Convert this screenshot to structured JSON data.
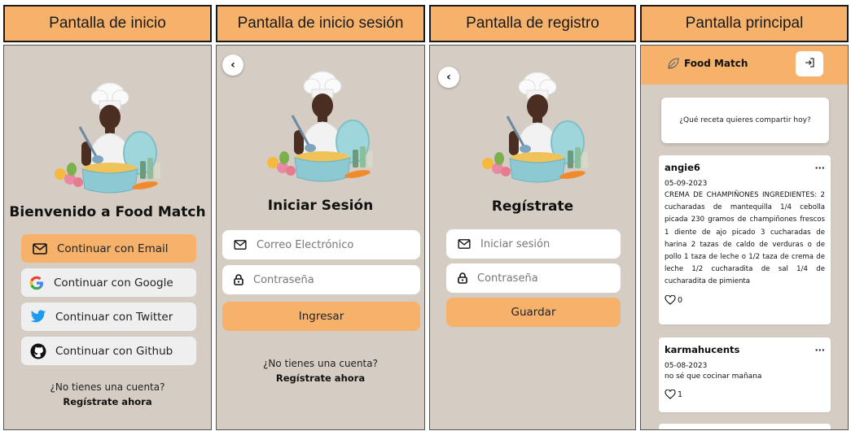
{
  "headers": [
    "Pantalla de inicio",
    "Pantalla de inicio sesión",
    "Pantalla de registro",
    "Pantalla principal"
  ],
  "welcome": {
    "title": "Bienvenido a Food Match",
    "buttons": [
      {
        "label": "Continuar con Email",
        "icon": "mail-icon"
      },
      {
        "label": "Continuar con Google",
        "icon": "google-icon"
      },
      {
        "label": "Continuar con Twitter",
        "icon": "twitter-icon"
      },
      {
        "label": "Continuar con Github",
        "icon": "github-icon"
      }
    ],
    "no_account": "¿No tienes una cuenta?",
    "register_link": "Regístrate ahora"
  },
  "login": {
    "title": "Iniciar Sesión",
    "email_placeholder": "Correo Electrónico",
    "password_placeholder": "Contraseña",
    "submit": "Ingresar",
    "no_account": "¿No tienes una cuenta?",
    "register_link": "Regístrate ahora"
  },
  "register": {
    "title": "Regístrate",
    "user_placeholder": "Iniciar sesión",
    "password_placeholder": "Contraseña",
    "submit": "Guardar"
  },
  "main": {
    "app_name": "Food Match",
    "prompt": "¿Qué receta quieres compartir hoy?",
    "posts": [
      {
        "user": "angie6",
        "more": "···",
        "date": "05-09-2023",
        "text": "CREMA DE CHAMPIÑONES INGREDIENTES: 2 cucharadas de mantequilla 1/4 cebolla picada 230 gramos de champiñones frescos 1 diente de ajo picado 3 cucharadas de harina 2 tazas de caldo de verduras o de pollo 1 taza de leche o 1/2 taza de crema de leche 1/2 cucharadita de sal 1/4 de cucharadita de pimienta",
        "likes": "0"
      },
      {
        "user": "karmahucents",
        "more": "···",
        "date": "05-08-2023",
        "text": "no sé que cocinar mañana",
        "likes": "1"
      }
    ]
  },
  "colors": {
    "accent": "#f6b26b",
    "screen_bg": "#d5cdc3"
  }
}
